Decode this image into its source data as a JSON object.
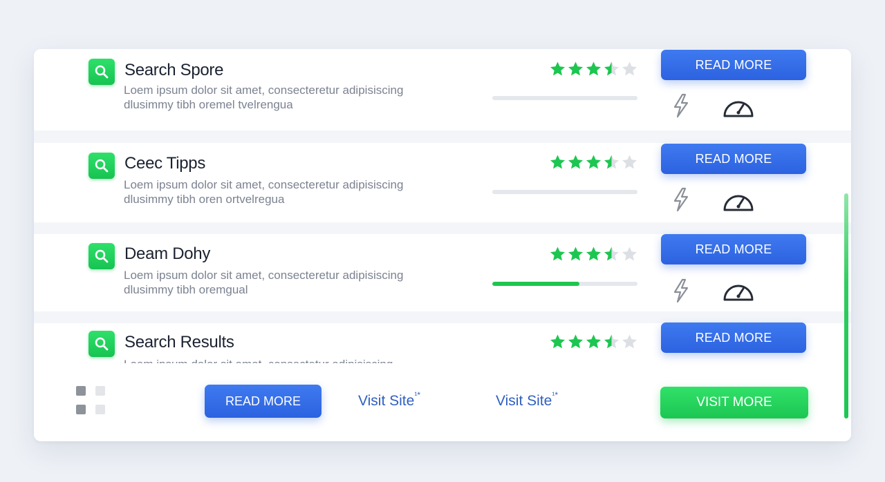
{
  "results": [
    {
      "title": "Search Spore",
      "desc_line1": "Loem ipsum dolor sit amet, consecteretur adipisiscing",
      "desc_line2": "dlusimmy tibh oremel tvelrengua",
      "rating": 3.5,
      "rating_max": 5,
      "progress": 0,
      "button": "READ MORE",
      "icons": [
        "search-icon",
        "lightning-icon",
        "speedometer-icon"
      ]
    },
    {
      "title": "Ceec Tipps",
      "desc_line1": "Loem ipsum dolor sit amet, consecteretur adipisiscing",
      "desc_line2": "dlusimmy tibh oren ortvelregua",
      "rating": 3.5,
      "rating_max": 5,
      "progress": 0,
      "button": "READ MORE",
      "icons": [
        "search-icon",
        "lightning-icon",
        "speedometer-icon"
      ]
    },
    {
      "title": "Deam Dohy",
      "desc_line1": "Loem ipsum dolor sit amet, consecteretur adipisiscing",
      "desc_line2": "dlusimmy tibh oremgual",
      "rating": 3.5,
      "rating_max": 5,
      "progress": 0.6,
      "button": "READ MORE",
      "icons": [
        "search-icon",
        "lightning-icon",
        "speedometer-icon"
      ]
    },
    {
      "title": "Search Results",
      "desc_line1": "Loem ipsum dolor sit amet, consectetur adipisiscing",
      "rating": 3.5,
      "rating_max": 5,
      "button": "READ MORE",
      "icons": [
        "search-icon"
      ]
    }
  ],
  "footer": {
    "grid_icon": "grid-icon",
    "read_more": "READ MORE",
    "visit_site_1": "Visit Site",
    "visit_site_1_mark": "¹*",
    "visit_site_2": "Visit Site",
    "visit_site_2_mark": "¹*",
    "visit_more": "VISIT MORE"
  },
  "colors": {
    "accent_green": "#1dc650",
    "accent_blue": "#2c62e0",
    "star_empty": "#dcdfe4",
    "text_dark": "#1b2230",
    "text_muted": "#7b8290"
  }
}
